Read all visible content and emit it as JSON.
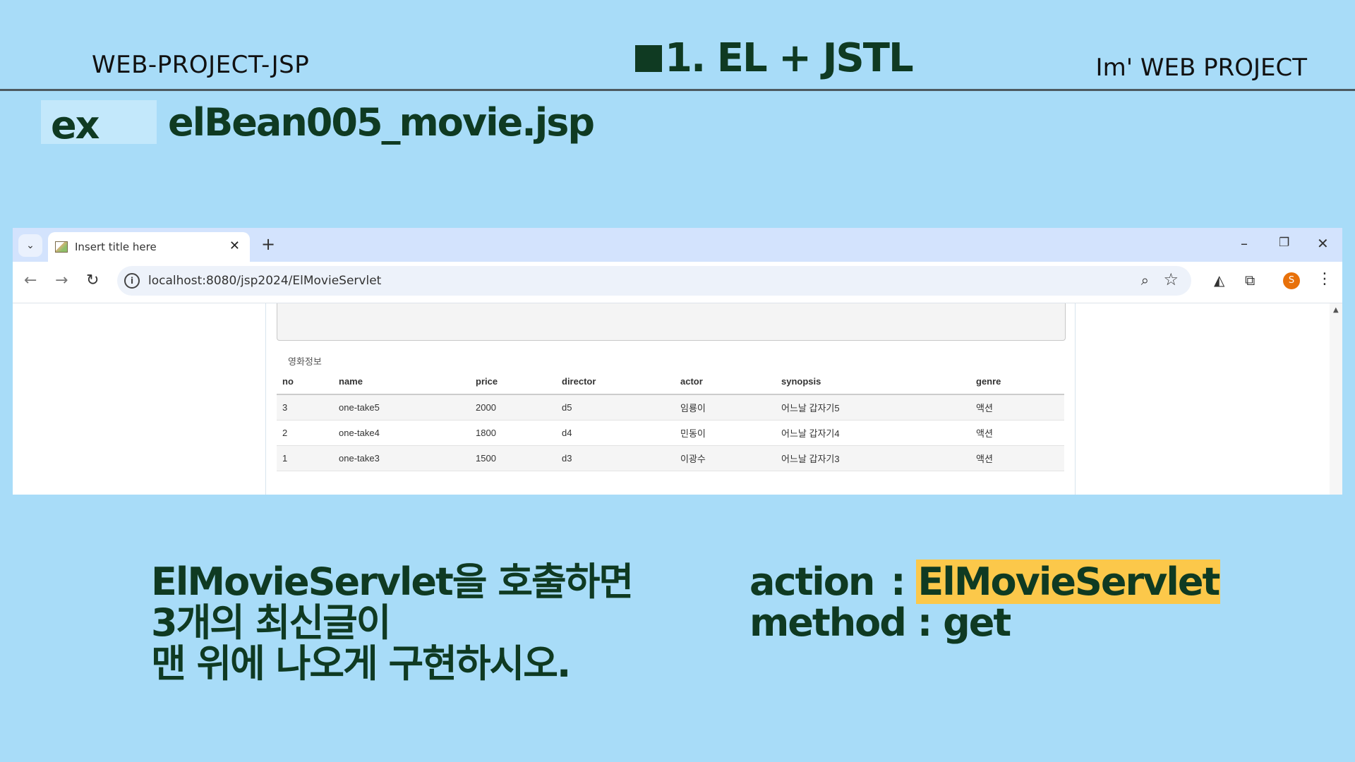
{
  "slide": {
    "header_left": "WEB-PROJECT-JSP",
    "header_center": "1. EL + JSTL",
    "header_right": "Im' WEB PROJECT",
    "ex_label": "ex",
    "ex_title": "elBean005_movie.jsp"
  },
  "browser": {
    "tab_title": "Insert title here",
    "tab_close": "✕",
    "new_tab": "+",
    "minimize": "–",
    "restore": "❐",
    "close": "✕",
    "url": "localhost:8080/jsp2024/ElMovieServlet",
    "profile_initial": "S"
  },
  "page": {
    "caption": "영화정보",
    "columns": [
      "no",
      "name",
      "price",
      "director",
      "actor",
      "synopsis",
      "genre"
    ],
    "rows": [
      [
        "3",
        "one-take5",
        "2000",
        "d5",
        "임룡이",
        "어느날 갑자기5",
        "액션"
      ],
      [
        "2",
        "one-take4",
        "1800",
        "d4",
        "민동이",
        "어느날 갑자기4",
        "액션"
      ],
      [
        "1",
        "one-take3",
        "1500",
        "d3",
        "이광수",
        "어느날 갑자기3",
        "액션"
      ]
    ]
  },
  "instructions": {
    "line1": "ElMovieServlet을 호출하면",
    "line2": "3개의 최신글이",
    "line3": "맨 위에 나오게 구현하시오."
  },
  "spec": {
    "action_label": "action",
    "action_sep": ":",
    "action_value": "ElMovieServlet",
    "method_label": "method",
    "method_sep": ":",
    "method_value": "get"
  },
  "colors": {
    "background": "#a8dcf8",
    "text_dark_green": "#0f3a22",
    "highlight": "#fcc84a",
    "tabbar": "#d3e3fd"
  }
}
